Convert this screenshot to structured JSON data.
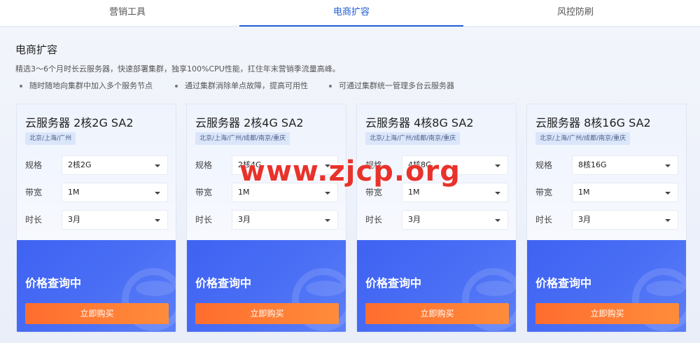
{
  "tabs": [
    {
      "label": "营销工具",
      "active": false
    },
    {
      "label": "电商扩容",
      "active": true
    },
    {
      "label": "风控防刷",
      "active": false
    }
  ],
  "section": {
    "title": "电商扩容",
    "description": "精选3～6个月时长云服务器，快速部署集群，独享100%CPU性能，扛住年末营销季流量高峰。",
    "bullets": [
      "随时随地向集群中加入多个服务节点",
      "通过集群消除单点故障，提高可用性",
      "可通过集群统一管理多台云服务器"
    ]
  },
  "cards": [
    {
      "name": "云服务器 2核2G SA2",
      "regions": "北京/上海/广州",
      "spec_label": "规格",
      "spec_value": "2核2G",
      "bandwidth_label": "带宽",
      "bandwidth_value": "1M",
      "duration_label": "时长",
      "duration_value": "3月",
      "price_text": "价格查询中",
      "buy_label": "立即购买"
    },
    {
      "name": "云服务器 2核4G SA2",
      "regions": "北京/上海/广州/成都/南京/重庆",
      "spec_label": "规格",
      "spec_value": "2核4G",
      "bandwidth_label": "带宽",
      "bandwidth_value": "1M",
      "duration_label": "时长",
      "duration_value": "3月",
      "price_text": "价格查询中",
      "buy_label": "立即购买"
    },
    {
      "name": "云服务器 4核8G SA2",
      "regions": "北京/上海/广州/成都/南京/重庆",
      "spec_label": "规格",
      "spec_value": "4核8G",
      "bandwidth_label": "带宽",
      "bandwidth_value": "1M",
      "duration_label": "时长",
      "duration_value": "3月",
      "price_text": "价格查询中",
      "buy_label": "立即购买"
    },
    {
      "name": "云服务器 8核16G SA2",
      "regions": "北京/上海/广州/成都/南京/重庆",
      "spec_label": "规格",
      "spec_value": "8核16G",
      "bandwidth_label": "带宽",
      "bandwidth_value": "1M",
      "duration_label": "时长",
      "duration_value": "3月",
      "price_text": "价格查询中",
      "buy_label": "立即购买"
    }
  ],
  "watermark": "www.zjcp.org",
  "colors": {
    "accent": "#1f5ed6",
    "card_bottom": "#4a6ff5",
    "buy_button": "#ff7a33",
    "watermark": "#e8322b"
  }
}
